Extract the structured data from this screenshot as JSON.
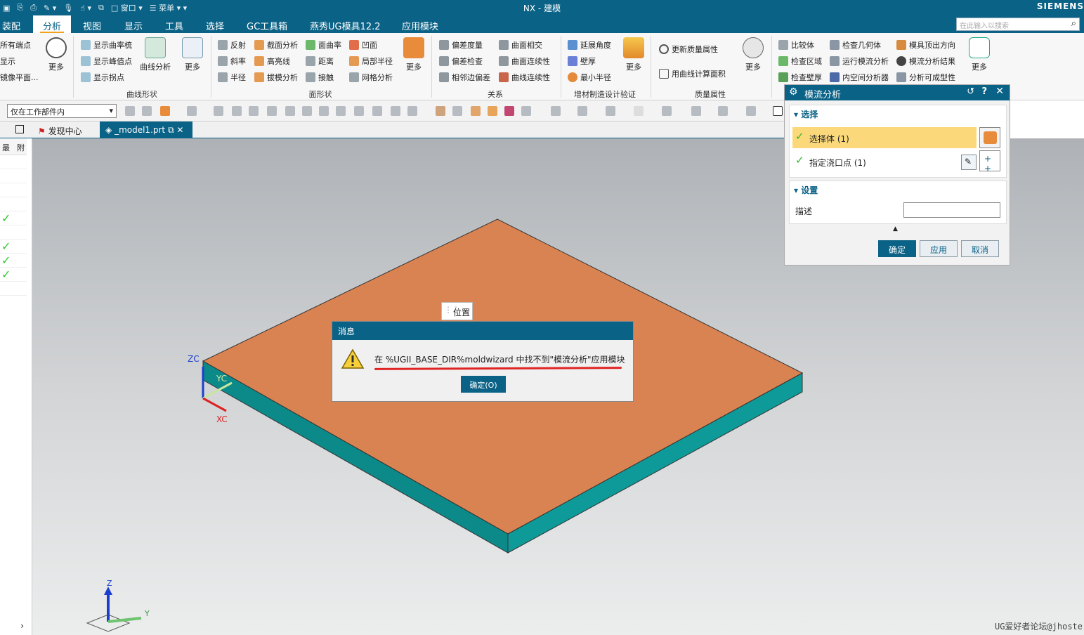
{
  "window": {
    "title": "NX - 建模",
    "brand": "SIEMENS"
  },
  "quickaccess": {
    "window_label": "窗口",
    "menu_label": "菜单"
  },
  "menubar": {
    "tabs": [
      "装配",
      "分析",
      "视图",
      "显示",
      "工具",
      "选择",
      "GC工具箱",
      "燕秀UG模具12.2",
      "应用模块"
    ],
    "active": "分析",
    "search_placeholder": "在此输入以搜索"
  },
  "ribbon": {
    "partial_left": [
      "所有端点",
      "显示",
      "镜像平面..."
    ],
    "curve_shape": {
      "items": [
        "显示曲率梳",
        "显示峰值点",
        "显示拐点"
      ],
      "big": [
        "曲线分析",
        "更多"
      ],
      "group": "曲线形状"
    },
    "more_label": "更多",
    "face_shape": {
      "col1": [
        "反射",
        "斜率",
        "半径"
      ],
      "col2": [
        "截面分析",
        "高亮线",
        "拔模分析"
      ],
      "col3": [
        "面曲率",
        "距离",
        "接触"
      ],
      "col4": [
        "凹面",
        "局部半径",
        "网格分析"
      ],
      "big": "更多",
      "group": "面形状"
    },
    "relation": {
      "col1": [
        "偏差度量",
        "偏差检查",
        "相邻边偏差"
      ],
      "col2": [
        "曲面相交",
        "曲面连续性",
        "曲线连续性"
      ],
      "group": "关系"
    },
    "additive": {
      "items": [
        "延展角度",
        "壁厚",
        "最小半径"
      ],
      "big": "更多",
      "group": "增材制造设计验证"
    },
    "mass": {
      "items": [
        "更新质量属性",
        "用曲线计算面积"
      ],
      "big": "更多",
      "group": "质量属性"
    },
    "mold": {
      "col1": [
        "比较体",
        "检查区域",
        "检查壁厚"
      ],
      "col2": [
        "检查几何体",
        "运行模流分析",
        "内空间分析器"
      ],
      "col3": [
        "模具顶出方向",
        "模流分析结果",
        "分析可成型性"
      ],
      "big": "更多"
    }
  },
  "toolbar": {
    "filter_value": "仅在工作部件内"
  },
  "doctabs": {
    "discovery": "发现中心",
    "model": "_model1.prt"
  },
  "leftpanel": {
    "col1": "最",
    "col2": "附"
  },
  "dialog": {
    "title": "模流分析",
    "select_section": "选择",
    "select_body": "选择体 (1)",
    "gate_point": "指定浇口点 (1)",
    "settings_section": "设置",
    "desc_label": "描述",
    "desc_value": "",
    "ok": "确定",
    "apply": "应用",
    "cancel": "取消"
  },
  "position_label": "位置",
  "message": {
    "title": "消息",
    "text": "在 %UGII_BASE_DIR%moldwizard 中找不到\"模流分析\"应用模块",
    "ok": "确定(O)"
  },
  "triad": {
    "zc": "ZC",
    "yc": "YC",
    "xc": "XC",
    "z": "Z",
    "y": "Y"
  },
  "watermark": "UG爱好者论坛@jhoste",
  "colors": {
    "accent": "#0a6286",
    "top_face": "#d98352",
    "side_face": "#0d9796",
    "selected": "#fbd97b"
  }
}
